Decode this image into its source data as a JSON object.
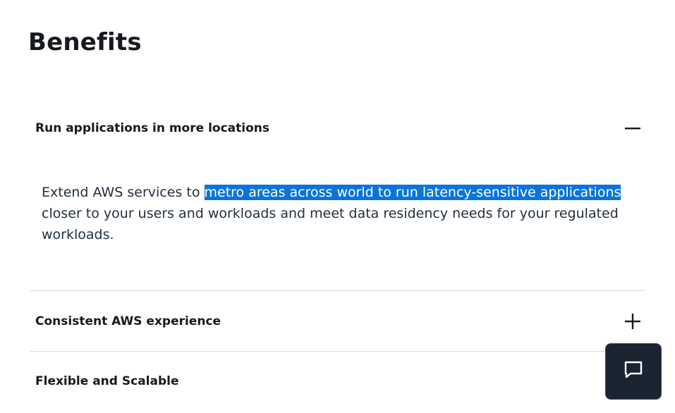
{
  "section": {
    "title": "Benefits"
  },
  "accordion": {
    "items": [
      {
        "title": "Run applications in more locations",
        "expanded": true,
        "body_pre": "Extend AWS services to ",
        "body_highlight": "metro areas across world to run latency-sensitive applications",
        "body_post": " closer to your users and workloads and meet data residency needs for your regulated workloads.",
        "toggle_icon": "minus-icon"
      },
      {
        "title": "Consistent AWS experience",
        "expanded": false,
        "toggle_icon": "plus-icon"
      },
      {
        "title": "Flexible and Scalable",
        "expanded": false,
        "toggle_icon": "plus-icon"
      }
    ]
  },
  "chat": {
    "icon": "chat-bubble-icon"
  },
  "colors": {
    "highlight_bg": "#0a74da",
    "chat_bg": "#1b2431",
    "divider": "#d5dbdb",
    "text": "#16191f"
  }
}
